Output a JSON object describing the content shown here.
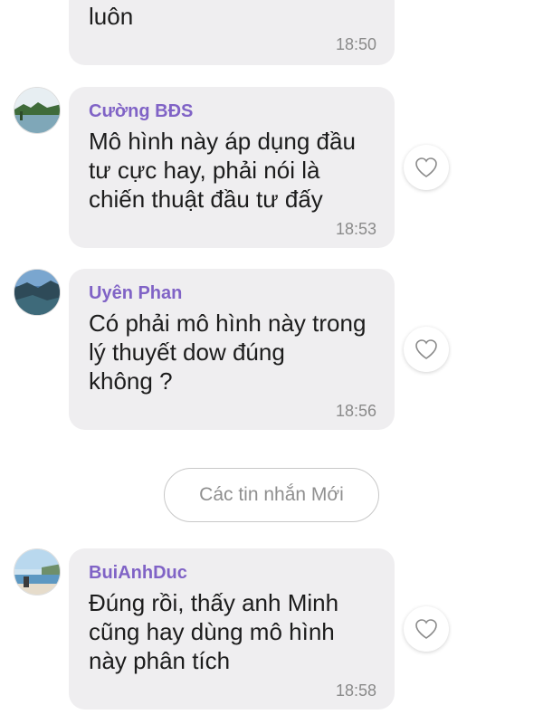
{
  "messages": [
    {
      "sender": "",
      "text": "luôn",
      "time": "18:50",
      "has_avatar": false
    },
    {
      "sender": "Cường BĐS",
      "text": "Mô hình này áp dụng đầu\ntư cực hay, phải nói là\nchiến thuật đầu tư đấy",
      "time": "18:53",
      "avatar": "landscape-avatar"
    },
    {
      "sender": "Uyên Phan",
      "text": "Có phải mô hình này trong\nlý thuyết dow đúng\nkhông ?",
      "time": "18:56",
      "avatar": "coast-avatar"
    },
    {
      "sender": "BuiAnhDuc",
      "text": "Đúng rồi, thấy anh Minh\ncũng hay dùng mô hình\nnày phân tích",
      "time": "18:58",
      "avatar": "beach-avatar"
    }
  ],
  "new_messages_divider": "Các tin nhắn Mới",
  "colors": {
    "sender": "#8063c6",
    "bubble": "#efeef0",
    "time": "#8a8a8a"
  }
}
